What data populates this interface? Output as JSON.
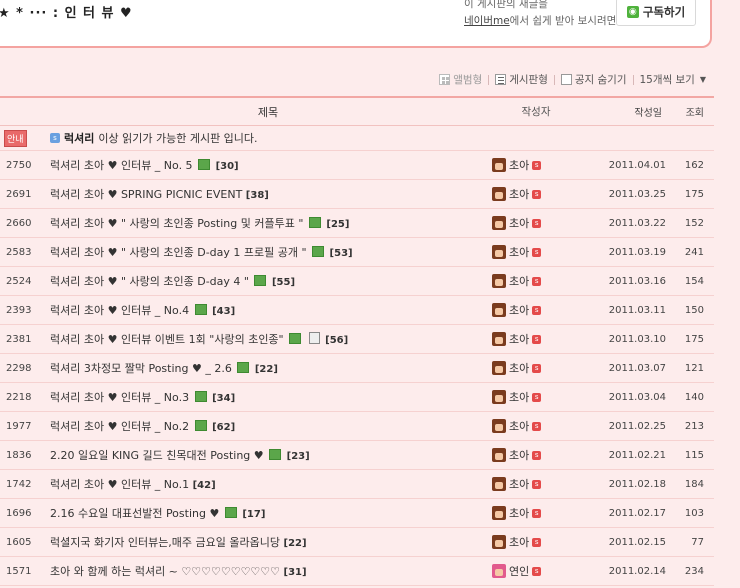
{
  "header": {
    "title": "★ * ··· : 인 터 뷰 ♥",
    "sub_line1": "이 게시판의 새글을",
    "sub_link": "네이버me",
    "sub_line2_rest": "에서 쉽게 받아 보시려면",
    "subscribe_label": "구독하기"
  },
  "toolbar": {
    "album_view": "앨범형",
    "board_view": "게시판형",
    "hide_notice": "공지 숨기기",
    "per_page": "15개씩 보기"
  },
  "columns": {
    "title": "제목",
    "author": "작성자",
    "date": "작성일",
    "views": "조회"
  },
  "notice": {
    "badge": "안내",
    "bold": "럭셔리",
    "text": "이상 읽기가 가능한 게시판 입니다."
  },
  "posts": [
    {
      "num": "2750",
      "title": "럭셔리 초아 ♥ 인터뷰 _ No. 5",
      "img": true,
      "file": false,
      "comments": "[30]",
      "author": "초아",
      "avatar": "brown",
      "date": "2011.04.01",
      "views": "162"
    },
    {
      "num": "2691",
      "title": "럭셔리 초아 ♥ SPRING PICNIC EVENT",
      "img": false,
      "file": false,
      "comments": "[38]",
      "author": "초아",
      "avatar": "brown",
      "date": "2011.03.25",
      "views": "175"
    },
    {
      "num": "2660",
      "title": "럭셔리 초아 ♥ \" 사랑의 초인종 Posting 및 커플투표 \"",
      "img": true,
      "file": false,
      "comments": "[25]",
      "author": "초아",
      "avatar": "brown",
      "date": "2011.03.22",
      "views": "152"
    },
    {
      "num": "2583",
      "title": "럭셔리 초아 ♥ \" 사랑의 초인종 D-day 1 프로필 공개 \"",
      "img": true,
      "file": false,
      "comments": "[53]",
      "author": "초아",
      "avatar": "brown",
      "date": "2011.03.19",
      "views": "241"
    },
    {
      "num": "2524",
      "title": "럭셔리 초아 ♥ \" 사랑의 초인종 D-day 4 \"",
      "img": true,
      "file": false,
      "comments": "[55]",
      "author": "초아",
      "avatar": "brown",
      "date": "2011.03.16",
      "views": "154"
    },
    {
      "num": "2393",
      "title": "럭셔리 초아 ♥ 인터뷰 _ No.4",
      "img": true,
      "file": false,
      "comments": "[43]",
      "author": "초아",
      "avatar": "brown",
      "date": "2011.03.11",
      "views": "150"
    },
    {
      "num": "2381",
      "title": "럭셔리 초아 ♥ 인터뷰 이벤트 1회 \"사랑의 초인종\"",
      "img": true,
      "file": true,
      "comments": "[56]",
      "author": "초아",
      "avatar": "brown",
      "date": "2011.03.10",
      "views": "175"
    },
    {
      "num": "2298",
      "title": "럭셔리 3차정모 짤막 Posting ♥ _ 2.6",
      "img": true,
      "file": false,
      "comments": "[22]",
      "author": "초아",
      "avatar": "brown",
      "date": "2011.03.07",
      "views": "121"
    },
    {
      "num": "2218",
      "title": "럭셔리 초아 ♥ 인터뷰 _ No.3",
      "img": true,
      "file": false,
      "comments": "[34]",
      "author": "초아",
      "avatar": "brown",
      "date": "2011.03.04",
      "views": "140"
    },
    {
      "num": "1977",
      "title": "럭셔리 초아 ♥ 인터뷰 _ No.2",
      "img": true,
      "file": false,
      "comments": "[62]",
      "author": "초아",
      "avatar": "brown",
      "date": "2011.02.25",
      "views": "213"
    },
    {
      "num": "1836",
      "title": "2.20 일요일 KING 길드 친목대전 Posting ♥",
      "img": true,
      "file": false,
      "comments": "[23]",
      "author": "초아",
      "avatar": "brown",
      "date": "2011.02.21",
      "views": "115"
    },
    {
      "num": "1742",
      "title": "럭셔리 초아 ♥ 인터뷰 _ No.1",
      "img": false,
      "file": false,
      "comments": "[42]",
      "author": "초아",
      "avatar": "brown",
      "date": "2011.02.18",
      "views": "184"
    },
    {
      "num": "1696",
      "title": "2.16 수요일 대표선발전 Posting ♥",
      "img": true,
      "file": false,
      "comments": "[17]",
      "author": "초아",
      "avatar": "brown",
      "date": "2011.02.17",
      "views": "103"
    },
    {
      "num": "1605",
      "title": "럭셜지국 화기자 인터뷰는,매주 금요일 올라옵니당",
      "img": false,
      "file": false,
      "comments": "[22]",
      "author": "초아",
      "avatar": "brown",
      "date": "2011.02.15",
      "views": "77"
    },
    {
      "num": "1571",
      "title": "초아 와 함께 하는 럭셔리 ~ ♡♡♡♡♡♡♡♡♡♡",
      "img": false,
      "file": false,
      "comments": "[31]",
      "author": "연인",
      "avatar": "pink",
      "date": "2011.02.14",
      "views": "234"
    }
  ]
}
